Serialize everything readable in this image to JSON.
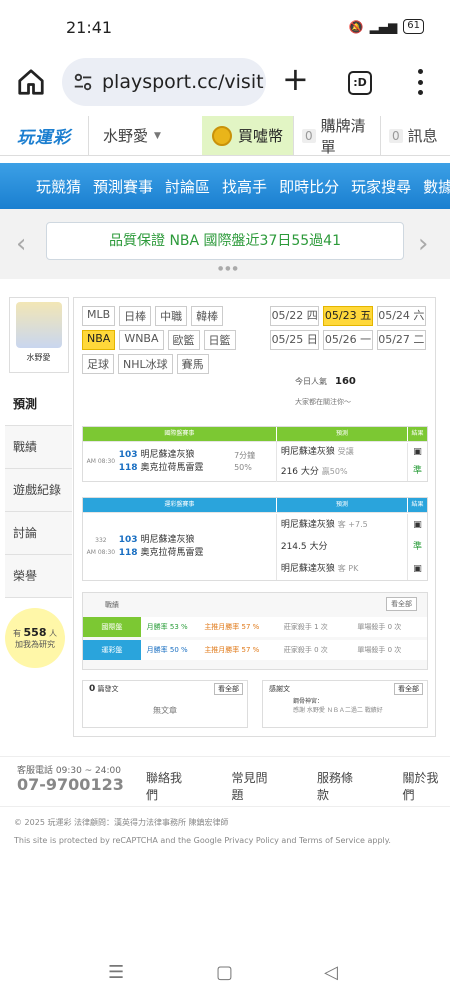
{
  "status": {
    "time": "21:41",
    "battery": "61"
  },
  "browser": {
    "url": "playsport.cc/visit"
  },
  "site": {
    "logo": "玩運彩",
    "user": "水野愛",
    "coin": "買噓幣",
    "cart_count": "0",
    "cart": "購牌清單",
    "msg_count": "0",
    "msg": "訊息"
  },
  "menu": [
    "玩競猜",
    "預測賽事",
    "討論區",
    "找高手",
    "即時比分",
    "玩家搜尋",
    "數據"
  ],
  "promo": "品質保證 NBA 國際盤近37日55過41",
  "profile": {
    "name": "水野愛",
    "nav": [
      "預測",
      "戰績",
      "遊戲紀錄",
      "討論",
      "榮譽"
    ],
    "bulb_pre": "有",
    "bulb_num": "558",
    "bulb_unit": "人",
    "bulb_txt": "加我為研究"
  },
  "leagues": [
    "MLB",
    "日棒",
    "中職",
    "韓棒",
    "NBA",
    "WNBA",
    "歐籃",
    "日籃",
    "足球",
    "NHL冰球",
    "賽馬"
  ],
  "active_league": "NBA",
  "dates": [
    "05/22 四",
    "05/23 五",
    "05/24 六",
    "05/25 日",
    "05/26 一",
    "05/27 二"
  ],
  "active_date": "05/23 五",
  "popularity": {
    "label": "今日人氣",
    "value": "160",
    "sub": "大家都在關注你～"
  },
  "intl": {
    "h1": "國際盤賽事",
    "h2": "預測",
    "h3": "結果",
    "time": "AM 08:30",
    "t1n": "103",
    "t1": "明尼蘇達灰狼",
    "t2n": "118",
    "t2": "奧克拉荷馬雷霆",
    "note": "7分鐘",
    "pct": "50%",
    "p1": "明尼蘇達灰狼",
    "p1s": "受讓",
    "p2": "216 大分",
    "p2s": "贏50%",
    "res": "準"
  },
  "taiwan": {
    "h1": "運彩盤賽事",
    "h2": "預測",
    "h3": "結果",
    "no": "332",
    "time": "AM 08:30",
    "t1n": "103",
    "t1": "明尼蘇達灰狼",
    "t2n": "118",
    "t2": "奧克拉荷馬雷霆",
    "p1": "明尼蘇達灰狼",
    "p1s": "客 +7.5",
    "p2": "214.5 大分",
    "p3": "明尼蘇達灰狼",
    "p3s": "客 PK",
    "res": "準"
  },
  "record": {
    "title": "戰績",
    "more": "看全部",
    "rows": [
      {
        "n": "國際盤",
        "w": "月勝率 53 %",
        "m": "主推月勝率 57 %",
        "s": "莊家殺手 1 次",
        "d": "單場殺手 0 次"
      },
      {
        "n": "運彩盤",
        "w": "月勝率 50 %",
        "m": "主推月勝率 57 %",
        "s": "莊家殺手 0 次",
        "d": "單場殺手 0 次"
      }
    ]
  },
  "posts": {
    "count": "0",
    "label": "篇發文",
    "more": "看全部",
    "empty": "無文章",
    "r_label": "感謝文",
    "r_more": "看全部",
    "r_title": "鋼骨神宮：",
    "r_sub": "感謝 水野愛 ＮＢＡ二過二 戰績好"
  },
  "footer": {
    "svc": "客服電話 09:30 ~ 24:00",
    "phone": "07-9700123",
    "links": [
      "聯絡我們",
      "常見問題",
      "服務條款",
      "關於我們"
    ],
    "copy": "© 2025 玩運彩 法律顧問：漢英得力法律事務所 陳鎮宏律師",
    "recap": "This site is protected by reCAPTCHA and the Google Privacy Policy and Terms of Service apply."
  }
}
